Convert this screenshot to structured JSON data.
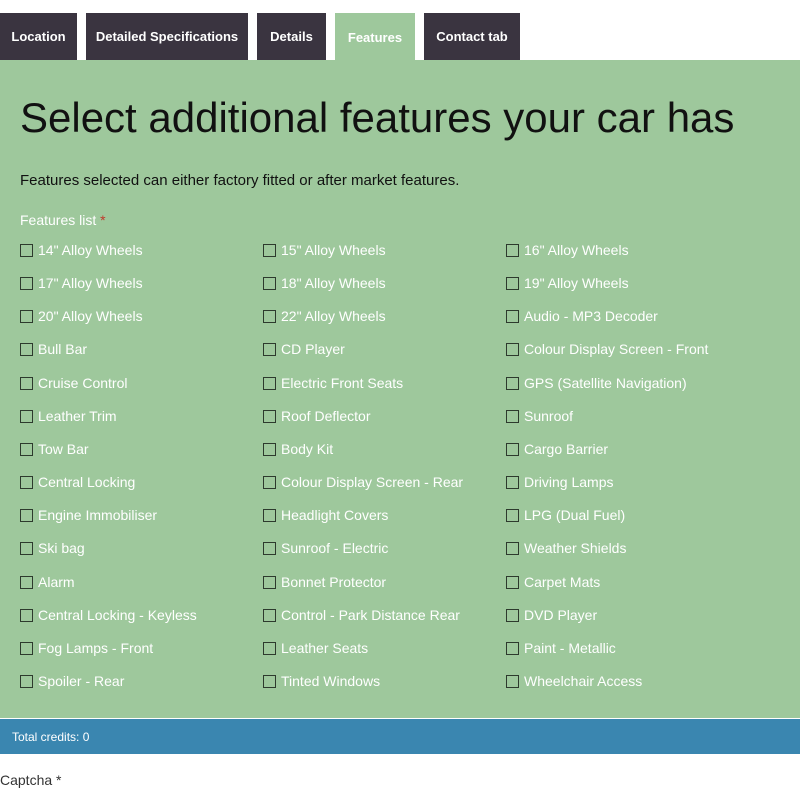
{
  "tabs": [
    {
      "label": "Location",
      "active": false
    },
    {
      "label": "Detailed Specifications",
      "active": false
    },
    {
      "label": "Details",
      "active": false
    },
    {
      "label": "Features",
      "active": true
    },
    {
      "label": "Contact tab",
      "active": false
    }
  ],
  "colors": {
    "tab_bg": "#3a3440",
    "panel_bg": "#9ec89c",
    "credits_bar": "#3a86b0",
    "required_star": "#c0392b"
  },
  "heading": "Select additional features your car has",
  "subtext": "Features selected can either factory fitted or after market features.",
  "features_label": "Features list",
  "required_marker": "*",
  "features": [
    [
      "14\" Alloy Wheels",
      "15\" Alloy Wheels",
      "16\" Alloy Wheels"
    ],
    [
      "17\" Alloy Wheels",
      "18\" Alloy Wheels",
      "19\" Alloy Wheels"
    ],
    [
      "20\" Alloy Wheels",
      "22\" Alloy Wheels",
      "Audio - MP3 Decoder"
    ],
    [
      "Bull Bar",
      "CD Player",
      "Colour Display Screen - Front"
    ],
    [
      "Cruise Control",
      "Electric Front Seats",
      "GPS (Satellite Navigation)"
    ],
    [
      "Leather Trim",
      "Roof Deflector",
      "Sunroof"
    ],
    [
      "Tow Bar",
      "Body Kit",
      "Cargo Barrier"
    ],
    [
      "Central Locking",
      "Colour Display Screen - Rear",
      "Driving Lamps"
    ],
    [
      "Engine Immobiliser",
      "Headlight Covers",
      "LPG (Dual Fuel)"
    ],
    [
      "Ski bag",
      "Sunroof - Electric",
      "Weather Shields"
    ],
    [
      "Alarm",
      "Bonnet Protector",
      "Carpet Mats"
    ],
    [
      "Central Locking - Keyless",
      "Control - Park Distance Rear",
      "DVD Player"
    ],
    [
      "Fog Lamps - Front",
      "Leather Seats",
      "Paint - Metallic"
    ],
    [
      "Spoiler - Rear",
      "Tinted Windows",
      "Wheelchair Access"
    ]
  ],
  "credits": "Total credits: 0",
  "captcha_label": "Captcha *"
}
